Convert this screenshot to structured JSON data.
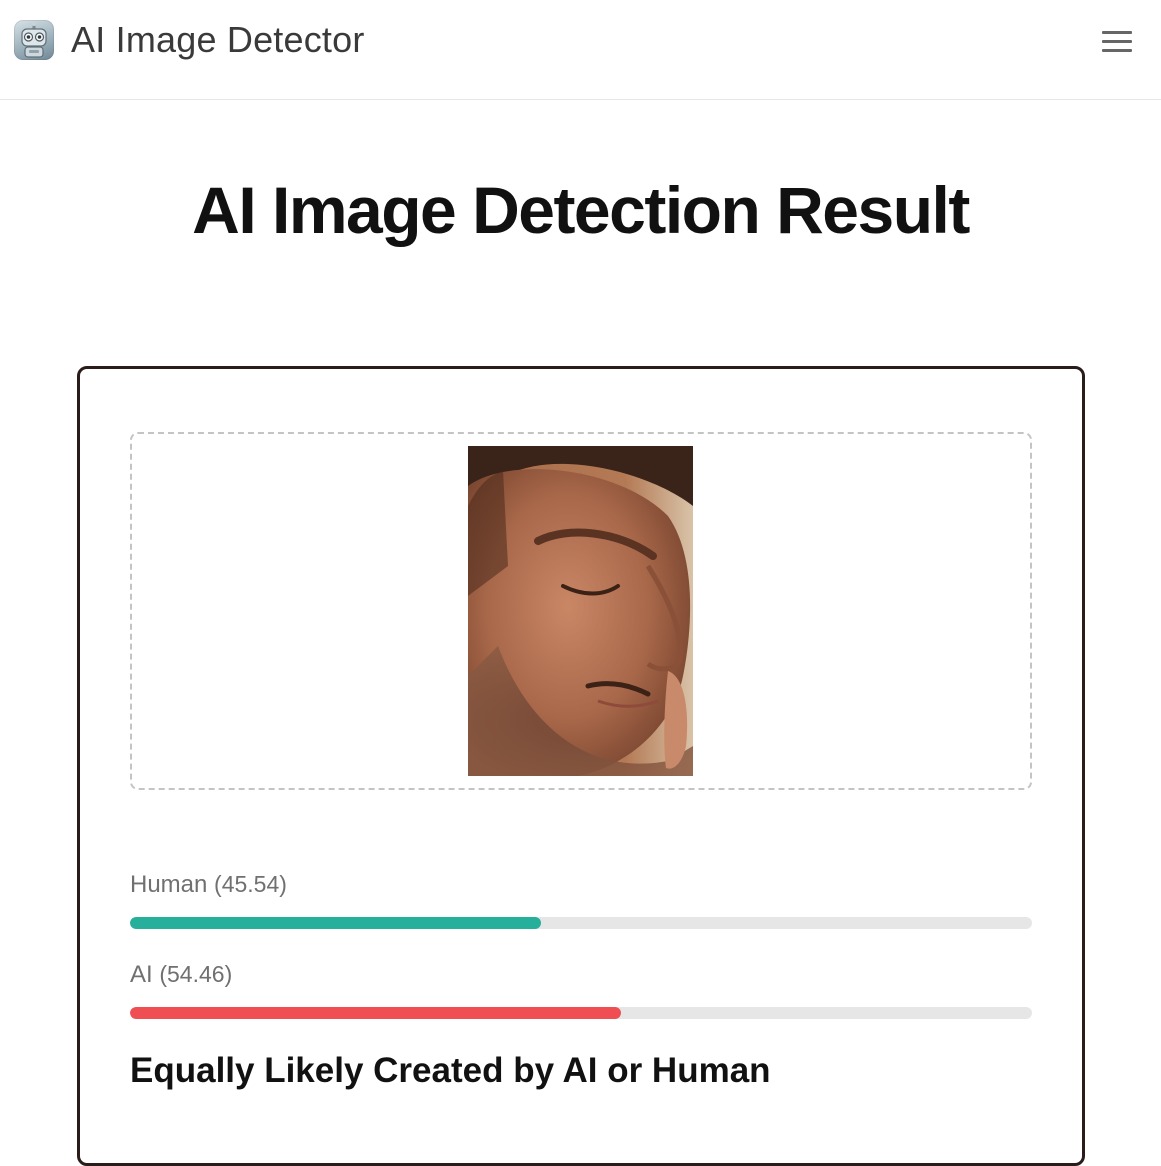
{
  "header": {
    "app_name": "AI Image Detector",
    "logo_icon": "robot-icon",
    "menu_icon": "hamburger-menu-icon"
  },
  "main": {
    "title": "AI Image Detection Result"
  },
  "result": {
    "image_description": "Uploaded photo of a man's face looking down",
    "scores": [
      {
        "label": "Human",
        "value_text": "(45.54)",
        "value": 45.54,
        "color": "#26b09b"
      },
      {
        "label": "AI",
        "value_text": "(54.46)",
        "value": 54.46,
        "color": "#ef4f52"
      }
    ],
    "verdict": "Equally Likely Created by AI or Human"
  },
  "colors": {
    "card_border": "#2a1c1a",
    "track": "#e6e6e6"
  }
}
